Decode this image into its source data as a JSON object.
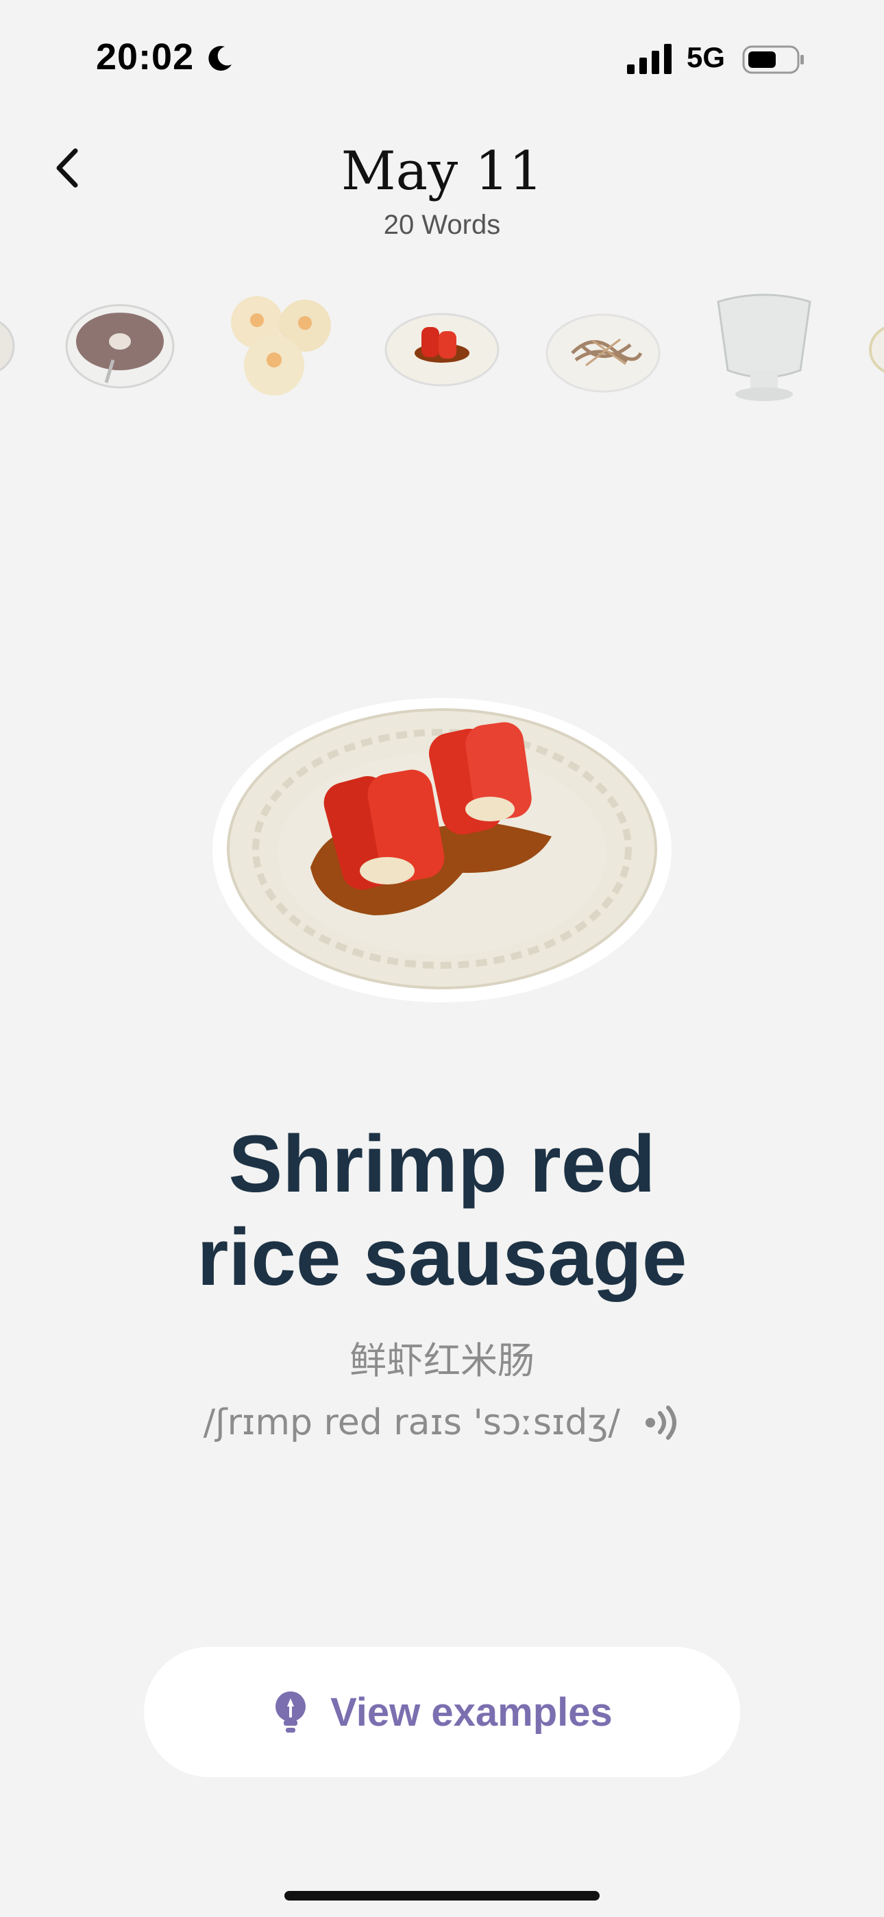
{
  "status_bar": {
    "time": "20:02",
    "network": "5G"
  },
  "header": {
    "title": "May 11",
    "subtitle": "20 Words"
  },
  "carousel": {
    "items": [
      "item-partial-left",
      "red-bean-soup",
      "shrimp-dumplings",
      "shrimp-rice-roll",
      "stir-fried-noodles",
      "glass-cup",
      "item-partial-right"
    ]
  },
  "word": {
    "line1": "Shrimp red",
    "line2": "rice sausage",
    "translation": "鲜虾红米肠",
    "phonetic": "/ʃrɪmp red raɪs 'sɔːsɪdʒ/"
  },
  "actions": {
    "view_examples": "View  examples"
  },
  "colors": {
    "word": "#1d3244",
    "accent": "#7b6fb0",
    "background": "#f3f3f3"
  }
}
